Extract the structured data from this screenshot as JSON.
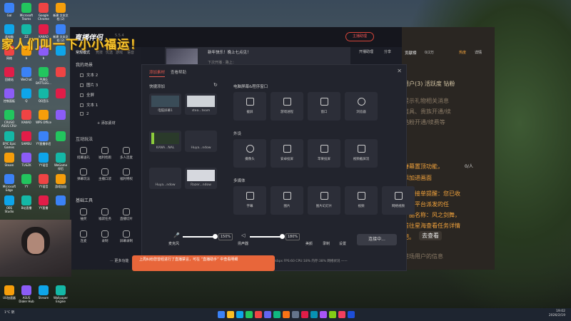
{
  "desktop": {
    "icons": [
      "Gal",
      "Microsoft Teams",
      "Google Chrome",
      "新建 文本文档 (2)",
      "",
      "此电脑",
      "ZZ",
      "KAKAO",
      "新建 文本文档 (2)",
      "",
      "网络",
      "b",
      "b",
      "",
      "",
      "回收站",
      "WeChat",
      "PUBG BATTLEG...",
      "",
      "",
      "控制面板",
      "Q",
      "QQ音乐",
      "",
      "",
      "CRUSO ASUS CRU-Z",
      "KAKAO",
      "WPS Office",
      "",
      "",
      "EPIC Epic Games Launcher",
      "SAMSU",
      "YY直播伴侣",
      "",
      "",
      "Steam",
      "TUSZK",
      "YY语音",
      "WeGame伴侣",
      "",
      "Microsoft Edge",
      "YY",
      "YY语音",
      "游戏加加",
      "",
      "OBS Studio",
      "B站直播",
      "YY直播",
      "",
      ""
    ],
    "bottom_icons": [
      "UU加速器",
      "ASUS Dialer Hub",
      "Stream",
      "Wallpaper Engine"
    ]
  },
  "overlay_banner": "家人们叫一下小小福运！",
  "app": {
    "logo": "直播伴侣",
    "version": "5.5.4",
    "live_button": "主播助理",
    "tabs": [
      "常规模式",
      "竞技",
      "优选",
      "游戏",
      "语音"
    ],
    "my_scenes_title": "我的场景",
    "scenes": [
      "文本 2",
      "图片 3",
      "全屏",
      "文本 1",
      "2"
    ],
    "add_material": "+ 添加素材",
    "interactive_title": "互动玩法",
    "interactive_tools": [
      "招募送礼",
      "福利抢跑",
      "多人连麦",
      "弹幕玩法",
      "主播口袋",
      "福利特权"
    ],
    "basic_title": "基础工具",
    "basic_tools": [
      "抽奖",
      "福袋任务",
      "直播切片",
      "连麦",
      "录制",
      "屏幕录制"
    ],
    "more_features": "··· 更多功能",
    "preview_title": "新年快乐！晚上七点见！",
    "preview_sub": "下次开播 · 路上：",
    "toolbar_right": [
      "开播助理",
      "分享"
    ],
    "mic_label": "麦克风",
    "mic_pct": "150%",
    "speaker_label": "扬声器",
    "speaker_pct": "180%",
    "extra_controls": [
      "美颜",
      "录制",
      "设置"
    ],
    "connect_button": "连接中...",
    "status_text": "码率:0kbps  FPS:60  CPU:18%  内存:38%  网络状况 ——",
    "tip": "上周纠纷您曾经进行了直播禁言，可在 “直播助手” 中查看明细",
    "right_panel": {
      "header": "贡献榜",
      "count": "0/2万",
      "badge": "热度",
      "detail": "详情",
      "lines": [
        "用户(3)  活跃度  钻粉",
        "提示礼物相关消息",
        "道具、贵族开通/续",
        "钻粉开通/续费等",
        "弹幕置顶功能，",
        "添加进画面",
        "任务接单提醒：您已收",
        "星海平台派发的任",
        "产品名称：风之剑舞，",
        "前往星海查看任务详情",
        "吧。",
        "去查看",
        "进场用户的信息"
      ],
      "highlight_label": "0/人"
    }
  },
  "modal": {
    "tabs": [
      "添加素材",
      "查看帮助"
    ],
    "quick_add": "快捷添加",
    "quick_cards": [
      "电脑屏幕1",
      "stea...team",
      "KANA...NAL",
      "Huya...ndow",
      "Huya...ndow",
      "Razer...ndow"
    ],
    "screen_section": "电脑屏幕&程序窗口",
    "screen_sources": [
      "截屏",
      "游戏进程",
      "窗口",
      "浏览器"
    ],
    "external_section": "外设",
    "external_sources": [
      "摄像头",
      "安卓投屏",
      "苹果投屏",
      "视频截屏流"
    ],
    "media_section": "多媒体",
    "media_sources": [
      "字幕",
      "图片",
      "图片幻灯片",
      "视频",
      "网络视频"
    ]
  },
  "taskbar": {
    "weather": "1°C 阴",
    "time": "19:02",
    "date": "2026/2/19"
  }
}
